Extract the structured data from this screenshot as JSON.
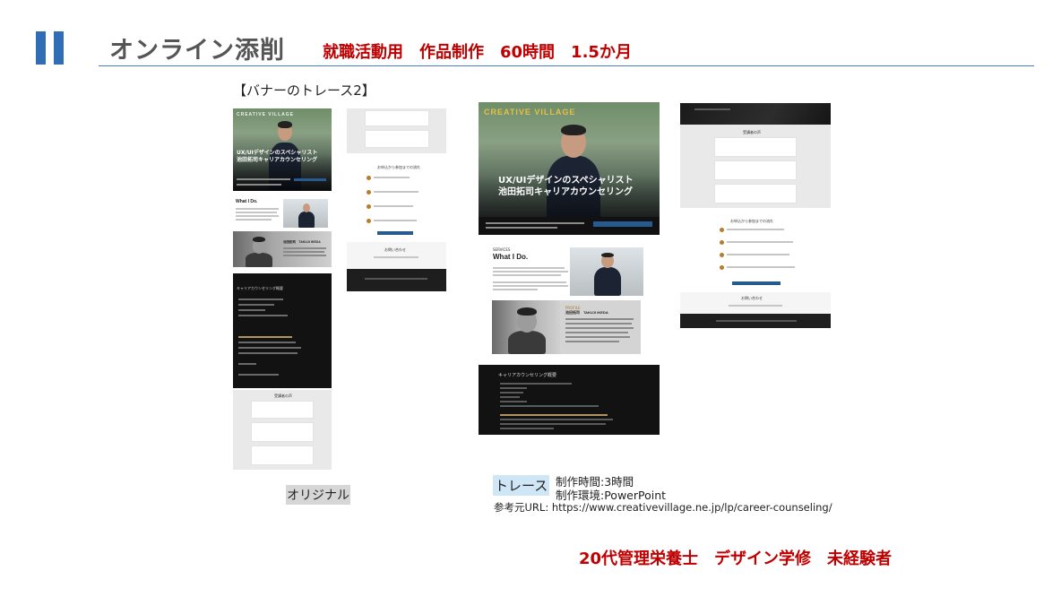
{
  "header": {
    "title": "オンライン添削",
    "subtitle": "就職活動用　作品制作　60時間　1.5か月",
    "accent_color": "#2f6db5",
    "subtitle_color": "#c00000"
  },
  "section_label": "【バナーのトレース2】",
  "original": {
    "caption": "オリジナル",
    "logo": "CREATIVE VILLAGE",
    "hero_title_line1": "UX/UIデザインのスペシャリスト",
    "hero_title_line2": "池田拓司キャリアカウンセリング",
    "what_i_do": "What I Do.",
    "profile_name": "池田拓司　TAKUJI IKEDA",
    "career_heading": "キャリアカウンセリング概要",
    "voice_heading": "受講者の声",
    "flow_heading": "お申込から参加までの流れ",
    "contact_heading": "お問い合わせ"
  },
  "trace": {
    "caption": "トレース",
    "logo": "CREATIVE VILLAGE",
    "hero_title_line1": "UX/UIデザインのスペシャリスト",
    "hero_title_line2": "池田拓司キャリアカウンセリング",
    "what_i_do": "What I Do.",
    "profile_label": "PROFILE",
    "profile_name": "池田拓司　TAKUJI IKEDA",
    "career_heading": "キャリアカウンセリング概要",
    "voice_heading": "受講者の声",
    "flow_heading": "お申込から参加までの流れ",
    "contact_heading": "お問い合わせ",
    "production_time": "制作時間:3時間",
    "environment": "制作環境:PowerPoint",
    "reference_url": "参考元URL: https://www.creativevillage.ne.jp/lp/career-counseling/"
  },
  "footer": {
    "note": "20代管理栄養士　デザイン学修　未経験者"
  }
}
